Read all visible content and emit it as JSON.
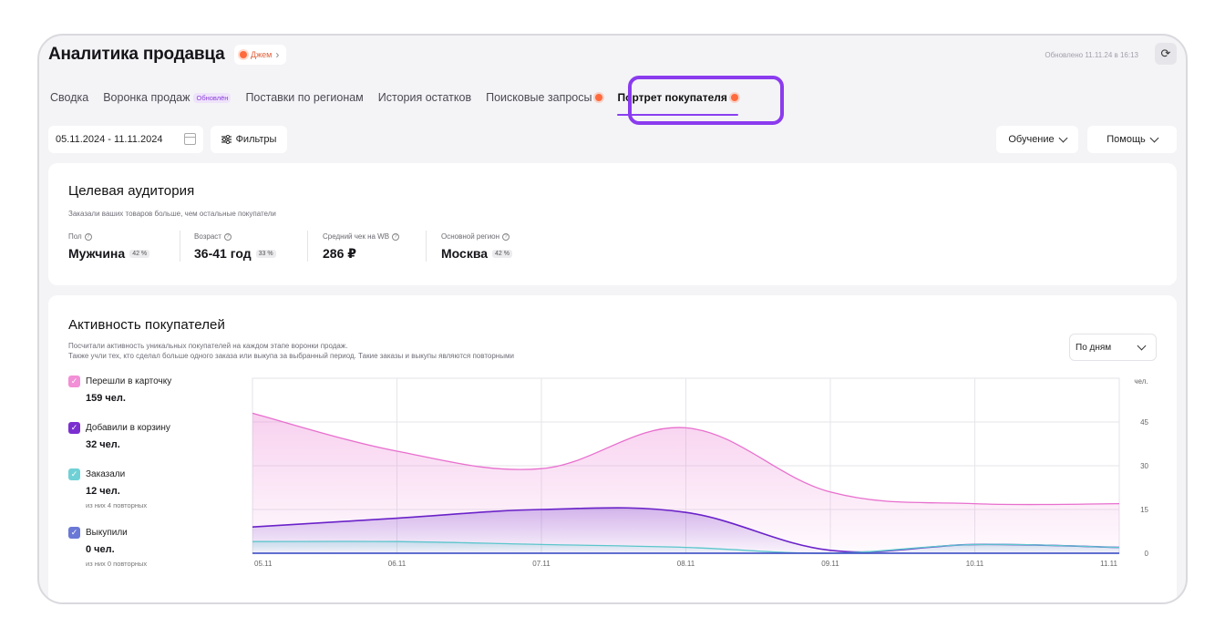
{
  "header": {
    "title": "Аналитика продавца",
    "brand": "Джем",
    "updated": "Обновлено 11.11.24 в 16:13"
  },
  "tabs": [
    {
      "label": "Сводка",
      "badge": "",
      "dot": false
    },
    {
      "label": "Воронка продаж",
      "badge": "Обновлён",
      "dot": false
    },
    {
      "label": "Поставки по регионам",
      "badge": "",
      "dot": false
    },
    {
      "label": "История остатков",
      "badge": "",
      "dot": false
    },
    {
      "label": "Поисковые запросы",
      "badge": "",
      "dot": true
    },
    {
      "label": "Портрет покупателя",
      "badge": "",
      "dot": true,
      "active": true
    }
  ],
  "toolbar": {
    "date_range": "05.11.2024 - 11.11.2024",
    "filters": "Фильтры",
    "education": "Обучение",
    "help": "Помощь"
  },
  "audience": {
    "title": "Целевая аудитория",
    "subtitle": "Заказали ваших товаров больше, чем остальные покупатели",
    "stats": [
      {
        "label": "Пол",
        "value": "Мужчина",
        "pct": "42 %"
      },
      {
        "label": "Возраст",
        "value": "36-41 год",
        "pct": "33 %"
      },
      {
        "label": "Средний чек на WB",
        "value": "286 ₽",
        "pct": ""
      },
      {
        "label": "Основной регион",
        "value": "Москва",
        "pct": "42 %"
      }
    ]
  },
  "activity": {
    "title": "Активность покупателей",
    "subtitle_1": "Посчитали активность уникальных покупателей на каждом этапе воронки продаж.",
    "subtitle_2": "Также учли тех, кто сделал больше одного заказа или выкупа за выбранный период. Такие заказы и выкупы являются повторными",
    "period": "По дням",
    "legend": [
      {
        "label": "Перешли в карточку",
        "value": "159 чел.",
        "note": "",
        "color": "#f28fd6"
      },
      {
        "label": "Добавили в корзину",
        "value": "32 чел.",
        "note": "",
        "color": "#7b2fd0"
      },
      {
        "label": "Заказали",
        "value": "12 чел.",
        "note": "из них 4 повторных",
        "color": "#6fd1d6"
      },
      {
        "label": "Выкупили",
        "value": "0 чел.",
        "note": "из них 0 повторных",
        "color": "#6a78d6"
      }
    ]
  },
  "chart_data": {
    "type": "area",
    "x": [
      "05.11",
      "06.11",
      "07.11",
      "08.11",
      "09.11",
      "10.11",
      "11.11"
    ],
    "y_unit": "чел.",
    "yticks": [
      0,
      15,
      30,
      45
    ],
    "ylim": [
      0,
      60
    ],
    "grid": true,
    "series": [
      {
        "name": "Перешли в карточку",
        "values": [
          48,
          35,
          29,
          43,
          21,
          17,
          17
        ],
        "color": "#e86fce"
      },
      {
        "name": "Добавили в корзину",
        "values": [
          9,
          12,
          15,
          14,
          1,
          3,
          2
        ],
        "color": "#6a22c9"
      },
      {
        "name": "Заказали",
        "values": [
          4,
          4,
          3,
          2,
          0,
          3,
          2
        ],
        "color": "#5cc6cc"
      },
      {
        "name": "Выкупили",
        "values": [
          0,
          0,
          0,
          0,
          0,
          0,
          0
        ],
        "color": "#3e4fc4"
      }
    ]
  }
}
